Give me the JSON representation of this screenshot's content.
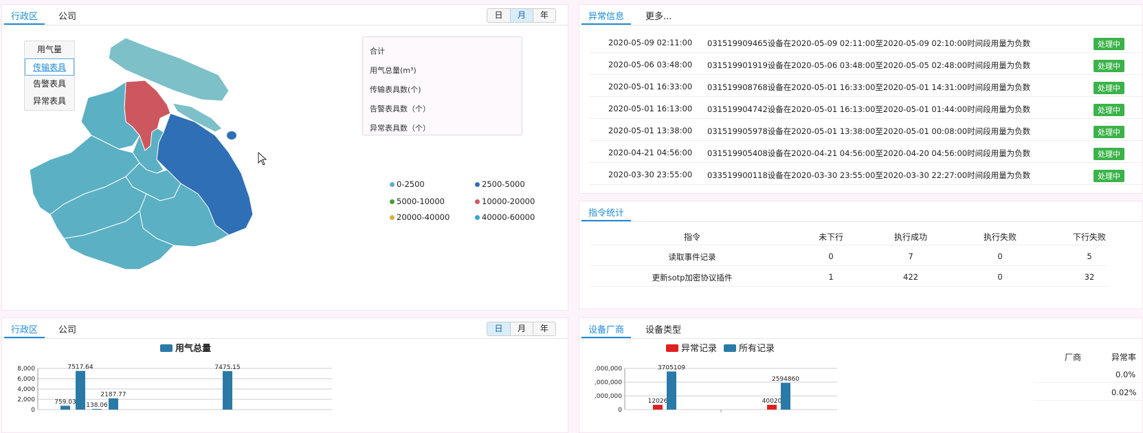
{
  "map_panel": {
    "tabs": [
      "行政区",
      "公司"
    ],
    "range": [
      "日",
      "月",
      "年"
    ],
    "layers": [
      "用气量",
      "传输表具",
      "告警表具",
      "异常表具"
    ],
    "summary": [
      "合计",
      "用气总量(m³)",
      "传输表具数(个)",
      "告警表具数（个）",
      "异常表具数（个）"
    ],
    "legend": [
      {
        "label": "0-2500",
        "color": "#5bb0c3"
      },
      {
        "label": "2500-5000",
        "color": "#2f6fb6"
      },
      {
        "label": "5000-10000",
        "color": "#4a9a3a"
      },
      {
        "label": "10000-20000",
        "color": "#cd575f"
      },
      {
        "label": "20000-40000",
        "color": "#d8b134"
      },
      {
        "label": "40000-60000",
        "color": "#2fa4dc"
      }
    ]
  },
  "alarm_panel": {
    "tabs": [
      "异常信息",
      "更多..."
    ],
    "rows": [
      {
        "time": "2020-05-09 02:11:00",
        "msg": "031519909465设备在2020-05-09 02:11:00至2020-05-09 02:10:00时间段用量为负数",
        "status": "处理中"
      },
      {
        "time": "2020-05-06 03:48:00",
        "msg": "031519901919设备在2020-05-06 03:48:00至2020-05-05 02:48:00时间段用量为负数",
        "status": "处理中"
      },
      {
        "time": "2020-05-01 16:33:00",
        "msg": "031519908768设备在2020-05-01 16:33:00至2020-05-01 14:31:00时间段用量为负数",
        "status": "处理中"
      },
      {
        "time": "2020-05-01 16:13:00",
        "msg": "031519904742设备在2020-05-01 16:13:00至2020-05-01 01:44:00时间段用量为负数",
        "status": "处理中"
      },
      {
        "time": "2020-05-01 13:38:00",
        "msg": "031519905978设备在2020-05-01 13:38:00至2020-05-01 00:08:00时间段用量为负数",
        "status": "处理中"
      },
      {
        "time": "2020-04-21 04:56:00",
        "msg": "031519905408设备在2020-04-21 04:56:00至2020-04-20 04:56:00时间段用量为负数",
        "status": "处理中"
      },
      {
        "time": "2020-03-30 23:55:00",
        "msg": "033519900118设备在2020-03-30 23:55:00至2020-03-30 22:27:00时间段用量为负数",
        "status": "处理中"
      }
    ]
  },
  "cmd_panel": {
    "tab": "指令统计",
    "headers": [
      "指令",
      "未下行",
      "执行成功",
      "执行失败",
      "下行失败"
    ],
    "rows": [
      [
        "读取事件记录",
        "0",
        "7",
        "0",
        "5"
      ],
      [
        "更新sotp加密协议插件",
        "1",
        "422",
        "0",
        "32"
      ]
    ]
  },
  "usage_panel": {
    "tabs": [
      "行政区",
      "公司"
    ],
    "range": [
      "日",
      "月",
      "年"
    ]
  },
  "vendor_panel": {
    "tabs": [
      "设备厂商",
      "设备类型"
    ],
    "table_headers": [
      "厂商",
      "异常率"
    ],
    "table_rows": [
      [
        "",
        "0.0%"
      ],
      [
        "",
        "0.02%"
      ]
    ]
  },
  "chart_data": [
    {
      "type": "bar",
      "legend": [
        "用气总量"
      ],
      "legend_color": "#2a7aa8",
      "ylim": [
        0,
        8000
      ],
      "yticks": [
        "8,000",
        "6,000",
        "4,000",
        "2,000",
        "0"
      ],
      "values": [
        759.03,
        7517.64,
        138.06,
        2187.77,
        7475.15
      ],
      "labels": [
        "759.03",
        "7517.64",
        "138.06",
        "2187.77",
        "7475.15"
      ]
    },
    {
      "type": "bar",
      "legend": [
        "异常记录",
        "所有记录"
      ],
      "colors": [
        "#e02020",
        "#2a7aa8"
      ],
      "yticks": [
        ",000,000",
        ",000,000",
        ",000,000",
        "0"
      ],
      "series": [
        {
          "name": "异常记录",
          "values": [
            12026,
            40020
          ],
          "labels": [
            "12026",
            "40020"
          ]
        },
        {
          "name": "所有记录",
          "values": [
            3705109,
            2594860
          ],
          "labels": [
            "3705109",
            "2594860"
          ]
        }
      ]
    }
  ]
}
